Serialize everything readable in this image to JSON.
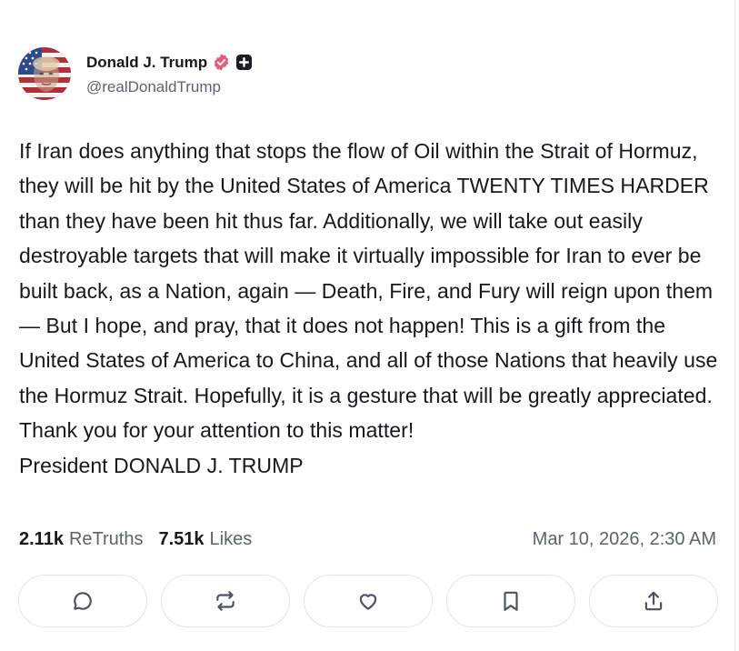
{
  "author": {
    "display_name": "Donald J. Trump",
    "handle": "@realDonaldTrump",
    "avatar_icon": "flag-portrait-avatar",
    "verified_icon": "verified-badge-icon",
    "verified_color": "#e55b7a",
    "plus_icon": "plus-badge-icon"
  },
  "post": {
    "text": "If Iran does anything that stops the flow of Oil within the Strait of Hormuz, they will be hit by the United States of America TWENTY TIMES HARDER than they have been hit thus far. Additionally, we will take out easily destroyable targets that will make it virtually impossible for Iran to ever be built back, as a Nation, again — Death, Fire, and Fury will reign upon them — But I hope, and pray, that it does not happen! This is a gift from the United States of America to China, and all of those Nations that heavily use the Hormuz Strait. Hopefully, it is a gesture that will be greatly appreciated. Thank you for your attention to this matter!\nPresident DONALD J. TRUMP",
    "timestamp": "Mar 10, 2026, 2:30 AM"
  },
  "stats": {
    "retruths_count": "2.11k",
    "retruths_label": "ReTruths",
    "likes_count": "7.51k",
    "likes_label": "Likes"
  },
  "actions": [
    {
      "icon": "reply-icon"
    },
    {
      "icon": "retruth-icon"
    },
    {
      "icon": "like-heart-icon"
    },
    {
      "icon": "bookmark-icon"
    },
    {
      "icon": "share-icon"
    }
  ]
}
